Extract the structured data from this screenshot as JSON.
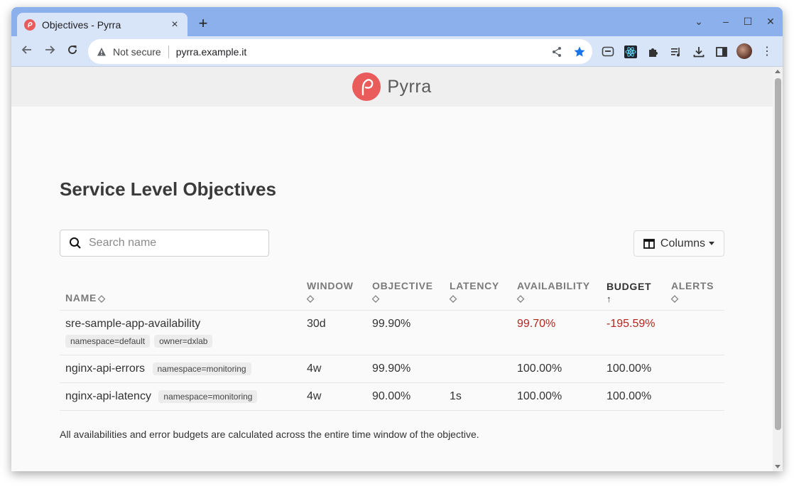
{
  "browser": {
    "tab_title": "Objectives - Pyrra",
    "tab_close": "×",
    "new_tab": "+",
    "not_secure": "Not secure",
    "url": "pyrra.example.it",
    "window_controls": {
      "dropdown": "⌄",
      "minimize": "–",
      "maximize": "☐",
      "close": "✕"
    }
  },
  "app": {
    "name": "Pyrra",
    "brand_color": "#ea5c5b"
  },
  "page": {
    "title": "Service Level Objectives",
    "search_placeholder": "Search name",
    "columns_label": "Columns",
    "footnote": "All availabilities and error budgets are calculated across the entire time window of the objective."
  },
  "table": {
    "headers": {
      "name": "NAME",
      "window": "WINDOW",
      "objective": "OBJECTIVE",
      "latency": "LATENCY",
      "availability": "AVAILABILITY",
      "budget": "BUDGET",
      "alerts": "ALERTS"
    },
    "sort_icons": {
      "unsorted": "◇",
      "ascending": "↑"
    },
    "rows": [
      {
        "name": "sre-sample-app-availability",
        "labels": [
          "namespace=default",
          "owner=dxlab"
        ],
        "window": "30d",
        "objective": "99.90%",
        "latency": "",
        "availability": "99.70%",
        "budget": "-195.59%",
        "alerts": ""
      },
      {
        "name": "nginx-api-errors",
        "labels": [
          "namespace=monitoring"
        ],
        "window": "4w",
        "objective": "99.90%",
        "latency": "",
        "availability": "100.00%",
        "budget": "100.00%",
        "alerts": ""
      },
      {
        "name": "nginx-api-latency",
        "labels": [
          "namespace=monitoring"
        ],
        "window": "4w",
        "objective": "90.00%",
        "latency": "1s",
        "availability": "100.00%",
        "budget": "100.00%",
        "alerts": ""
      }
    ]
  },
  "colors": {
    "negative": "#b3261e",
    "tabbar": "#8bb0ec",
    "toolbar": "#d8e4f8"
  }
}
